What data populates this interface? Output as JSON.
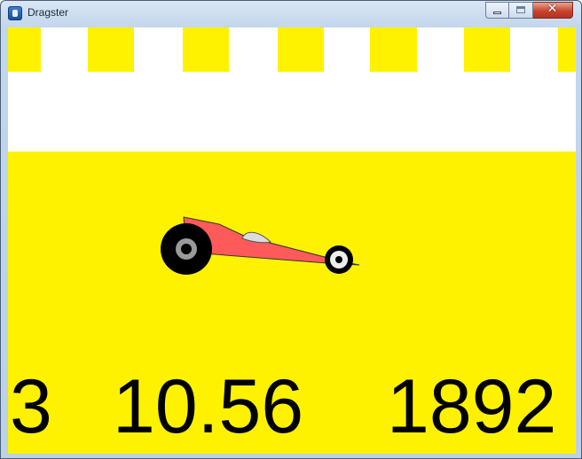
{
  "window": {
    "title": "Dragster",
    "close_glyph": "✕"
  },
  "icons": {
    "app": "dragster-app-icon",
    "minimize": "minimize-icon",
    "maximize": "maximize-icon",
    "close": "close-icon"
  },
  "colors": {
    "track": "#fff200",
    "sky": "#ffffff",
    "car_body": "#ff5a5a",
    "tire": "#000000",
    "hub": "#9a9a9a",
    "text": "#000000"
  },
  "hud": {
    "lap": "3",
    "time": "10.56",
    "rpm": "1892"
  }
}
